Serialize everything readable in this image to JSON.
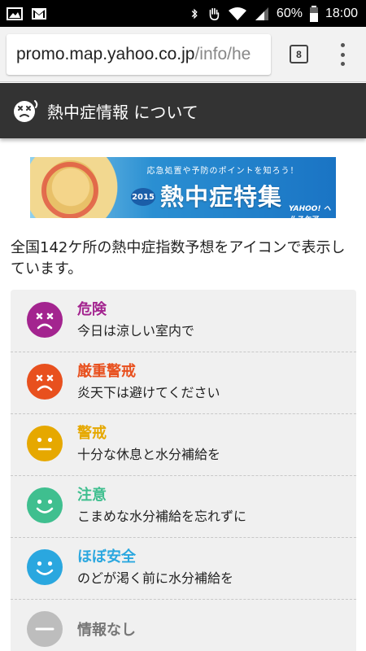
{
  "status_bar": {
    "battery": "60%",
    "time": "18:00"
  },
  "browser": {
    "url_host": "promo.map.yahoo.co.jp",
    "url_path": "/info/he",
    "tab_count": "8"
  },
  "header": {
    "title": "熱中症情報 について"
  },
  "banner": {
    "subtitle": "応急処置や予防のポイントを知ろう！",
    "year": "2015",
    "title": "熱中症特集",
    "logo": "YAHOO! ヘルスケア"
  },
  "intro": "全国142ケ所の熱中症指数予想をアイコンで表示しています。",
  "levels": [
    {
      "name": "危険",
      "desc": "今日は涼しい室内で",
      "color": "#a3248f",
      "face": "x-eyes-frown",
      "icon": "danger-face-icon"
    },
    {
      "name": "厳重警戒",
      "desc": "炎天下は避けてください",
      "color": "#e8501e",
      "face": "x-eyes-frown",
      "icon": "severe-warning-face-icon"
    },
    {
      "name": "警戒",
      "desc": "十分な休息と水分補給を",
      "color": "#e6a800",
      "face": "neutral",
      "icon": "warning-face-icon"
    },
    {
      "name": "注意",
      "desc": "こまめな水分補給を忘れずに",
      "color": "#3fbf8f",
      "face": "smile",
      "icon": "caution-face-icon"
    },
    {
      "name": "ほぼ安全",
      "desc": "のどが渇く前に水分補給を",
      "color": "#2aa7df",
      "face": "smile",
      "icon": "almost-safe-face-icon"
    },
    {
      "name": "情報なし",
      "desc": "",
      "color": "#bdbdbd",
      "face": "dash",
      "icon": "no-info-icon"
    }
  ]
}
